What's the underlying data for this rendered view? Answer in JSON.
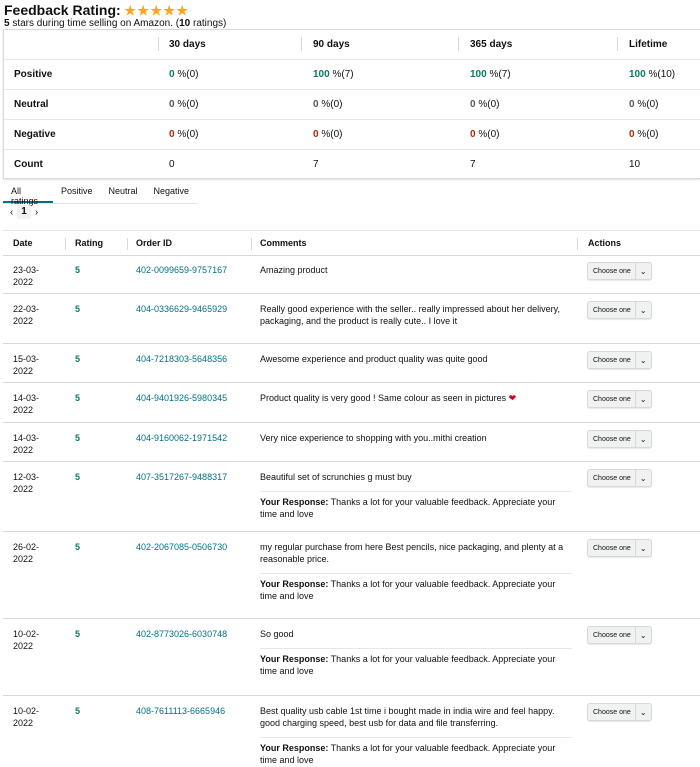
{
  "header": {
    "title": "Feedback Rating:",
    "stars": [
      "★",
      "★",
      "★",
      "★",
      "★"
    ],
    "subtitle_prefix": "5",
    "subtitle_middle": " stars during time selling on Amazon. (",
    "subtitle_count": "10",
    "subtitle_suffix": " ratings)"
  },
  "summary": {
    "columns": [
      "30 days",
      "90 days",
      "365 days",
      "Lifetime"
    ],
    "rows": [
      {
        "label": "Positive",
        "cells": [
          {
            "num": "0",
            "rest": " %(0)"
          },
          {
            "num": "100",
            "rest": " %(7)"
          },
          {
            "num": "100",
            "rest": " %(7)"
          },
          {
            "num": "100",
            "rest": " %(10)"
          }
        ]
      },
      {
        "label": "Neutral",
        "cells": [
          {
            "num": "0",
            "rest": " %(0)"
          },
          {
            "num": "0",
            "rest": " %(0)"
          },
          {
            "num": "0",
            "rest": " %(0)"
          },
          {
            "num": "0",
            "rest": " %(0)"
          }
        ]
      },
      {
        "label": "Negative",
        "cells": [
          {
            "num": "0",
            "rest": " %(0)"
          },
          {
            "num": "0",
            "rest": " %(0)"
          },
          {
            "num": "0",
            "rest": " %(0)"
          },
          {
            "num": "0",
            "rest": " %(0)"
          }
        ]
      },
      {
        "label": "Count",
        "cells": [
          {
            "num": "",
            "rest": "0"
          },
          {
            "num": "",
            "rest": "7"
          },
          {
            "num": "",
            "rest": "7"
          },
          {
            "num": "",
            "rest": "10"
          }
        ]
      }
    ]
  },
  "tabs": [
    "All ratings",
    "Positive",
    "Neutral",
    "Negative"
  ],
  "pager": {
    "prev": "‹",
    "page": "1",
    "next": "›"
  },
  "table": {
    "headers": [
      "Date",
      "Rating",
      "Order ID",
      "Comments",
      "Actions"
    ],
    "action_label": "Choose one",
    "response_label": "Your Response:",
    "rows": [
      {
        "date": "23-03-2022",
        "rating": "5",
        "order_id": "402-0099659-9757167",
        "comment": "Amazing product",
        "response": ""
      },
      {
        "date": "22-03-2022",
        "rating": "5",
        "order_id": "404-0336629-9465929",
        "comment": "Really good experience with the seller.. really impressed about her delivery, packaging, and the product is really cute.. I love it",
        "response": ""
      },
      {
        "date": "15-03-2022",
        "rating": "5",
        "order_id": "404-7218303-5648356",
        "comment": "Awesome experience and product quality was quite good",
        "response": ""
      },
      {
        "date": "14-03-2022",
        "rating": "5",
        "order_id": "404-9401926-5980345",
        "comment": "Product quality is very good ! Same colour as seen in pictures ",
        "heart": "❤",
        "response": ""
      },
      {
        "date": "14-03-2022",
        "rating": "5",
        "order_id": "404-9160062-1971542",
        "comment": "Very nice experience to shopping with you..mithi creation",
        "response": ""
      },
      {
        "date": "12-03-2022",
        "rating": "5",
        "order_id": "407-3517267-9488317",
        "comment": "Beautiful set of scrunchies g must buy",
        "response": " Thanks a lot for your valuable feedback. Appreciate your time and love"
      },
      {
        "date": "26-02-2022",
        "rating": "5",
        "order_id": "402-2067085-0506730",
        "comment": "my regular purchase from here Best pencils, nice packaging, and plenty at a reasonable price.",
        "response": " Thanks a lot for your valuable feedback. Appreciate your time and love"
      },
      {
        "date": "10-02-2022",
        "rating": "5",
        "order_id": "402-8773026-6030748",
        "comment": "So good",
        "response": " Thanks a lot for your valuable feedback. Appreciate your time and love"
      },
      {
        "date": "10-02-2022",
        "rating": "5",
        "order_id": "408-7611113-6665946",
        "comment": "Best quality usb cable 1st time i bought made in india wire and feel happy. good charging speed, best usb for data and file transferring.",
        "response": " Thanks a lot for your valuable feedback. Appreciate your time and love"
      }
    ]
  },
  "colors": {
    "positive": "#067d62",
    "negative": "#b12704",
    "link": "#007185",
    "star": "#ffa41c"
  }
}
